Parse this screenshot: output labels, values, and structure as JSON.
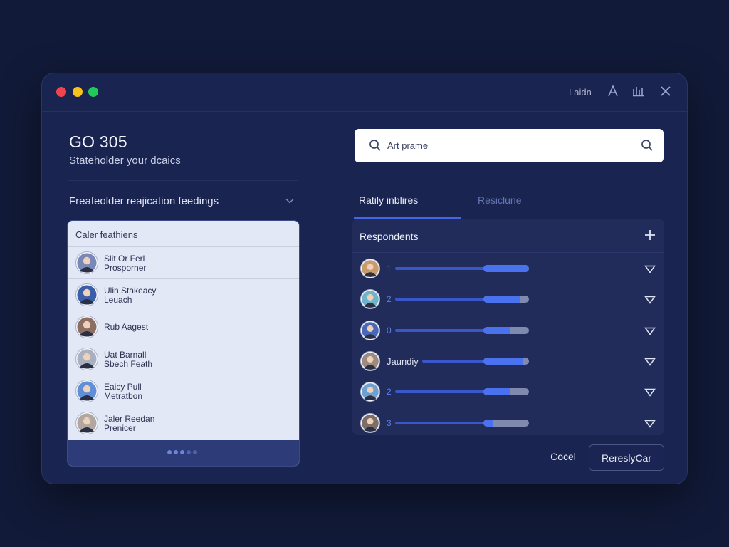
{
  "titlebar": {
    "dots": [
      {
        "name": "close-dot",
        "color": "#ef4550"
      },
      {
        "name": "minimize-dot",
        "color": "#f6c21c"
      },
      {
        "name": "maximize-dot",
        "color": "#23c85a"
      }
    ],
    "label": "Laidn",
    "icons": [
      "user-icon",
      "bar-chart-icon",
      "close-icon"
    ]
  },
  "left": {
    "title": "GO 305",
    "subtitle": "Stateholder your dcaics",
    "section_label": "Freafeolder reajication feedings",
    "list": {
      "header": "Caler feathiens",
      "items": [
        {
          "name": "Slit Or Ferl",
          "sub": "Prosporner",
          "avatar_color": "#7a88b8"
        },
        {
          "name": "Ulin Stakeacy",
          "sub": "Leuach",
          "avatar_color": "#3a5fa8"
        },
        {
          "name": "Rub Aagest",
          "sub": "",
          "avatar_color": "#8a6f62"
        },
        {
          "name": "Uat Barnall",
          "sub": "Sbech Feath",
          "avatar_color": "#a9b0bf"
        },
        {
          "name": "Eaicy Pull",
          "sub": "Metratbon",
          "avatar_color": "#5f8fd6"
        },
        {
          "name": "Jaler Reedan",
          "sub": "Prenicer",
          "avatar_color": "#b0a7a0"
        }
      ],
      "pager_dots": 5,
      "pager_active": 3
    }
  },
  "right": {
    "search": {
      "value": "Art prame"
    },
    "tabs": [
      {
        "label": "Ratily inblires",
        "active": true
      },
      {
        "label": "Resiclune",
        "active": false
      }
    ],
    "respondents": {
      "title": "Respondents",
      "rows": [
        {
          "label": "1",
          "progress": 1.0,
          "avatar_color": "#c99a6a"
        },
        {
          "label": "2",
          "progress": 0.8,
          "avatar_color": "#6fb3c9"
        },
        {
          "label": "0",
          "progress": 0.6,
          "avatar_color": "#4a68b8"
        },
        {
          "label": "Jaundiy",
          "progress": 0.88,
          "avatar_color": "#9d8a80"
        },
        {
          "label": "2",
          "progress": 0.6,
          "avatar_color": "#6fa0d0"
        },
        {
          "label": "3",
          "progress": 0.2,
          "avatar_color": "#7d6f68"
        }
      ]
    },
    "buttons": {
      "cancel": "Cocel",
      "primary": "RereslyCar"
    }
  },
  "colors": {
    "accent": "#4266e6",
    "background": "#111a38",
    "window": "#1a2450"
  }
}
